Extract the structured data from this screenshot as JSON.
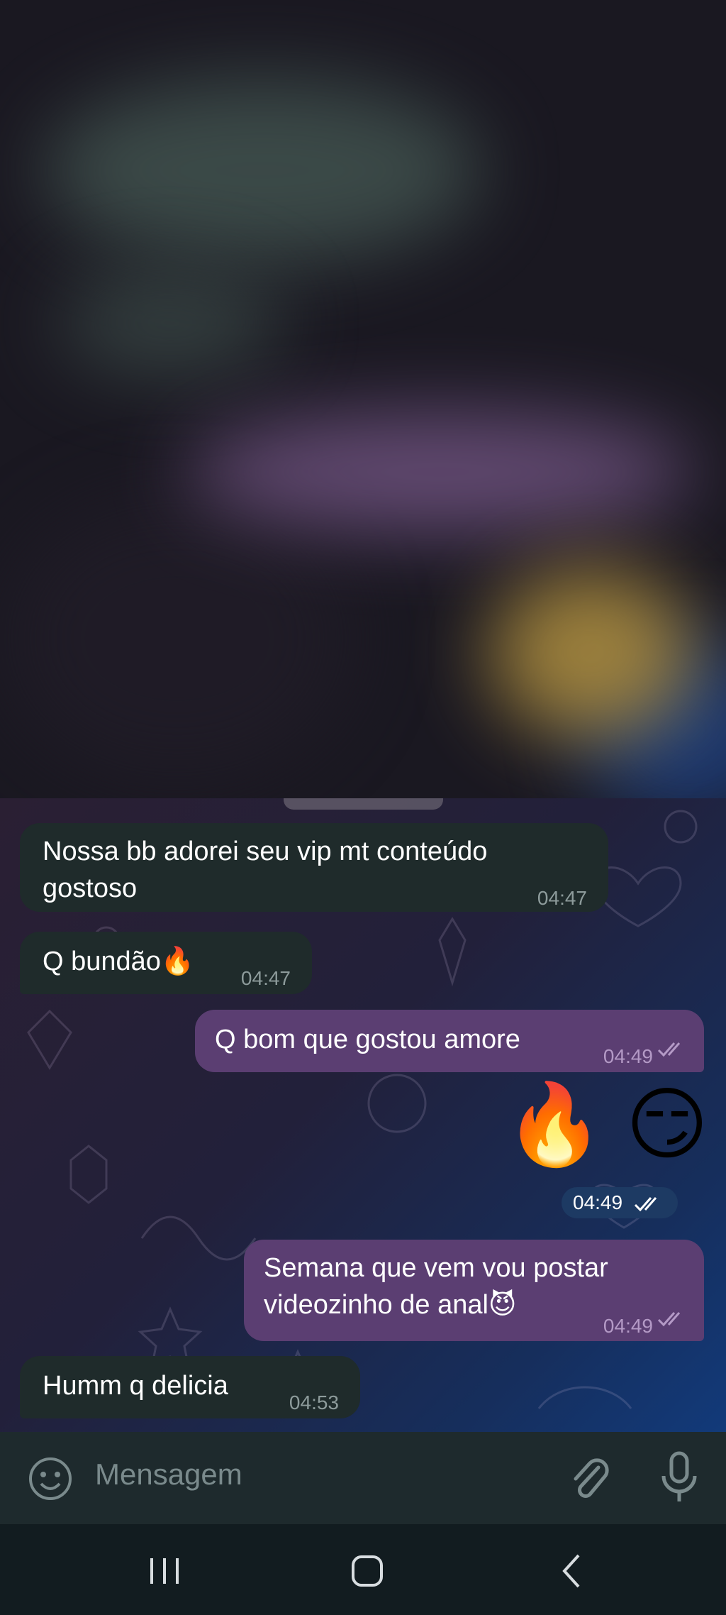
{
  "messages": [
    {
      "direction": "incoming",
      "text_line1": "Nossa bb adorei seu vip mt conteúdo",
      "text_line2": "gostoso",
      "time": "04:47"
    },
    {
      "direction": "incoming",
      "text": "Q bundão🔥",
      "time": "04:47"
    },
    {
      "direction": "outgoing",
      "text": "Q bom que gostou amore",
      "time": "04:49",
      "status": "read"
    },
    {
      "direction": "outgoing",
      "type": "emoji",
      "text": "🔥 😏",
      "time": "04:49",
      "status": "read"
    },
    {
      "direction": "outgoing",
      "text_line1": "Semana que vem vou postar",
      "text_line2": "videozinho de anal😈",
      "time": "04:49",
      "status": "read"
    },
    {
      "direction": "incoming",
      "text": "Humm q delicia",
      "time": "04:53"
    }
  ],
  "composer": {
    "placeholder": "Mensagem",
    "icons": [
      "emoji-icon",
      "attach-icon",
      "mic-icon"
    ]
  },
  "navigation": {
    "icons": [
      "recent-apps-icon",
      "home-icon",
      "back-icon"
    ]
  },
  "colors": {
    "incoming_bubble": "#1f2b2b",
    "outgoing_bubble": "#5b3e72",
    "read_ticks": "#b49ac6"
  }
}
